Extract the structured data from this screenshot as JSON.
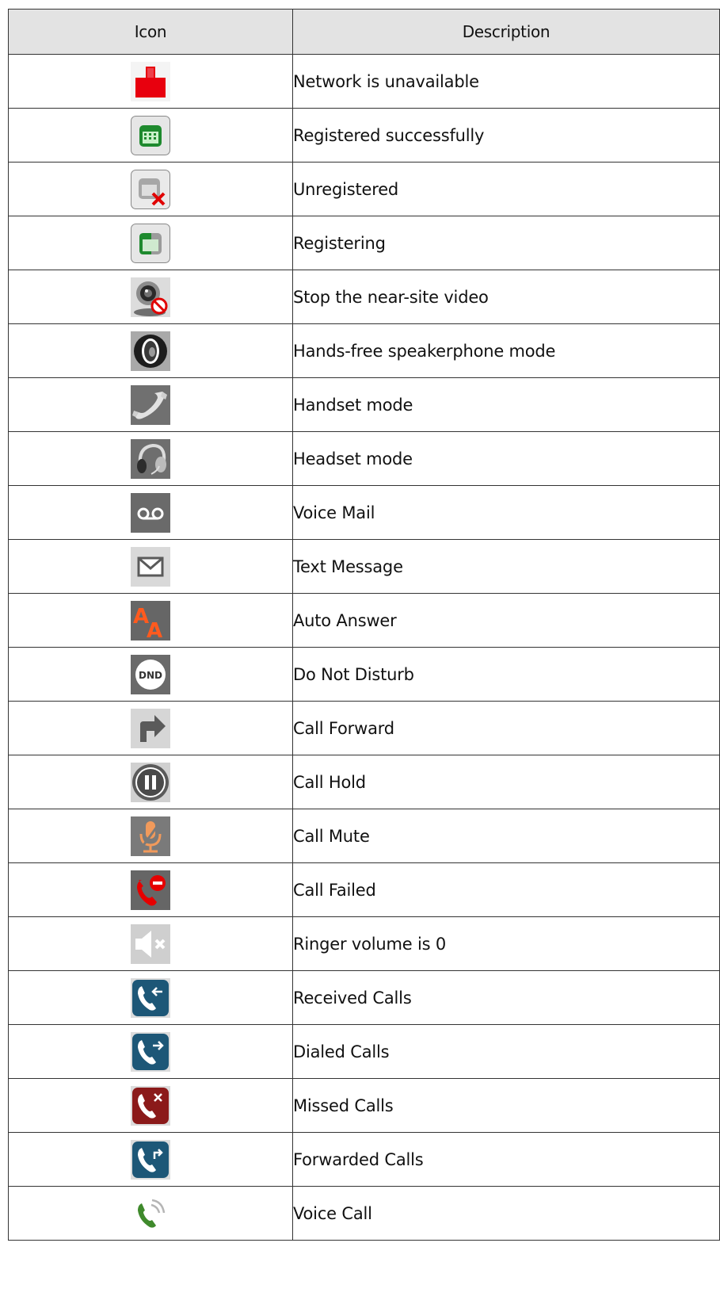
{
  "table": {
    "header": {
      "icon": "Icon",
      "description": "Description"
    },
    "rows": [
      {
        "icon": "network-unavailable-icon",
        "description": "Network is unavailable"
      },
      {
        "icon": "registered-icon",
        "description": "Registered successfully"
      },
      {
        "icon": "unregistered-icon",
        "description": "Unregistered"
      },
      {
        "icon": "registering-icon",
        "description": "Registering"
      },
      {
        "icon": "stop-video-icon",
        "description": "Stop the near-site video"
      },
      {
        "icon": "speakerphone-icon",
        "description": "Hands-free speakerphone mode"
      },
      {
        "icon": "handset-icon",
        "description": "Handset mode"
      },
      {
        "icon": "headset-icon",
        "description": "Headset mode"
      },
      {
        "icon": "voice-mail-icon",
        "description": "Voice Mail"
      },
      {
        "icon": "text-message-icon",
        "description": "Text Message"
      },
      {
        "icon": "auto-answer-icon",
        "description": "Auto Answer"
      },
      {
        "icon": "dnd-icon",
        "description": "Do Not Disturb"
      },
      {
        "icon": "call-forward-icon",
        "description": "Call Forward"
      },
      {
        "icon": "call-hold-icon",
        "description": "Call Hold"
      },
      {
        "icon": "call-mute-icon",
        "description": "Call Mute"
      },
      {
        "icon": "call-failed-icon",
        "description": "Call Failed"
      },
      {
        "icon": "ringer-muted-icon",
        "description": "Ringer volume is 0"
      },
      {
        "icon": "received-calls-icon",
        "description": "Received Calls"
      },
      {
        "icon": "dialed-calls-icon",
        "description": "Dialed Calls"
      },
      {
        "icon": "missed-calls-icon",
        "description": "Missed Calls"
      },
      {
        "icon": "forwarded-calls-icon",
        "description": "Forwarded Calls"
      },
      {
        "icon": "voice-call-icon",
        "description": "Voice Call"
      }
    ]
  }
}
